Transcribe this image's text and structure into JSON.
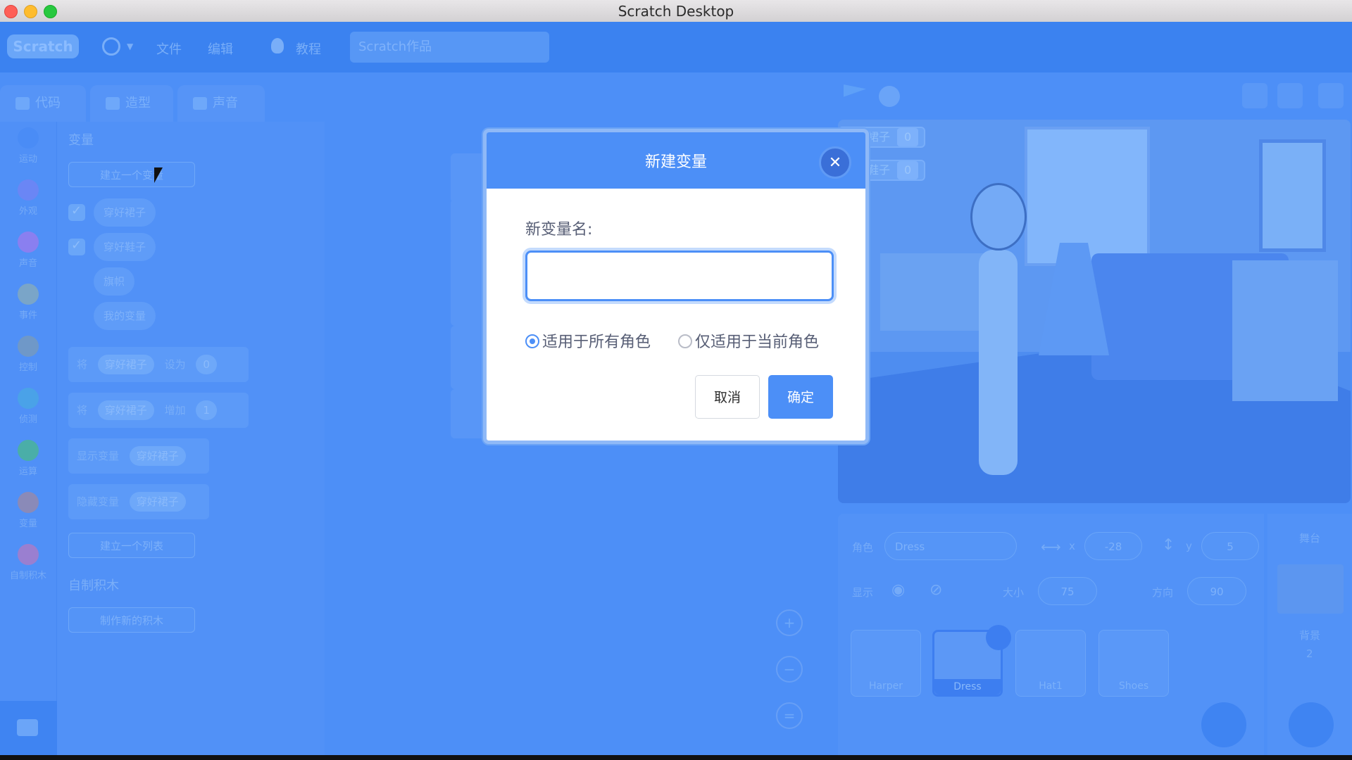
{
  "window": {
    "title": "Scratch Desktop"
  },
  "menubar": {
    "logo": "Scratch",
    "file": "文件",
    "edit": "编辑",
    "tutorials": "教程",
    "project_title": "Scratch作品"
  },
  "tabs": [
    {
      "label": "代码"
    },
    {
      "label": "造型"
    },
    {
      "label": "声音"
    }
  ],
  "categories": [
    {
      "label": "运动",
      "color": "#4a8cf6"
    },
    {
      "label": "外观",
      "color": "#6a86f5"
    },
    {
      "label": "声音",
      "color": "#8a7ff0"
    },
    {
      "label": "事件",
      "color": "#7aa5c8"
    },
    {
      "label": "控制",
      "color": "#6f98c8"
    },
    {
      "label": "侦测",
      "color": "#4aa2e8"
    },
    {
      "label": "运算",
      "color": "#4aaea8"
    },
    {
      "label": "变量",
      "color": "#8a8ab8"
    },
    {
      "label": "自制积木",
      "color": "#9a7fd0"
    }
  ],
  "palette": {
    "variables_heading": "变量",
    "make_variable": "建立一个变量",
    "variables": [
      "穿好裙子",
      "穿好鞋子",
      "旗帜",
      "我的变量"
    ],
    "block_set": {
      "prefix": "将",
      "var": "穿好裙子",
      "mid": "设为",
      "value": "0"
    },
    "block_change": {
      "prefix": "将",
      "var": "穿好裙子",
      "mid": "增加",
      "value": "1"
    },
    "block_show": {
      "prefix": "显示变量",
      "var": "穿好裙子"
    },
    "block_hide": {
      "prefix": "隐藏变量",
      "var": "穿好裙子"
    },
    "make_list": "建立一个列表",
    "my_blocks_heading": "自制积木",
    "make_block": "制作新的积木"
  },
  "stage_monitors": [
    {
      "label": "穿好裙子",
      "value": "0"
    },
    {
      "label": "穿好鞋子",
      "value": "0"
    }
  ],
  "sprite_info": {
    "sprite_label": "角色",
    "sprite_name": "Dress",
    "x_label": "x",
    "x_value": "-28",
    "y_label": "y",
    "y_value": "5",
    "show_label": "显示",
    "size_label": "大小",
    "size_value": "75",
    "direction_label": "方向",
    "direction_value": "90"
  },
  "sprites": [
    {
      "name": "Harper",
      "selected": false
    },
    {
      "name": "Dress",
      "selected": true
    },
    {
      "name": "Hat1",
      "selected": false
    },
    {
      "name": "Shoes",
      "selected": false
    }
  ],
  "stage_pane": {
    "label": "舞台",
    "backdrops_label": "背景",
    "backdrops_count": "2"
  },
  "dialog": {
    "title": "新建变量",
    "field_label": "新变量名:",
    "input_value": "",
    "option_all": "适用于所有角色",
    "option_this": "仅适用于当前角色",
    "cancel": "取消",
    "ok": "确定"
  }
}
